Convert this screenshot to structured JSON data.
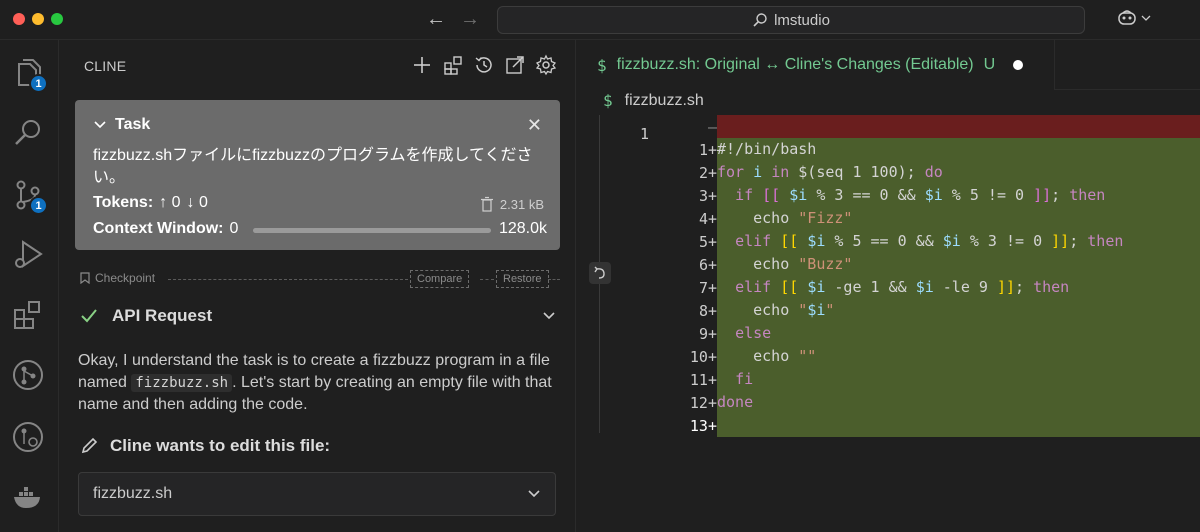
{
  "window": {
    "search_text": "lmstudio"
  },
  "activity": {
    "explorer_badge": "1",
    "scm_badge": "1"
  },
  "sidebar": {
    "title": "CLINE",
    "task": {
      "heading": "Task",
      "text": "fizzbuzz.shファイルにfizzbuzzのプログラムを作成してください。",
      "tokens_label": "Tokens:",
      "tokens_up": "↑ 0",
      "tokens_down": "↓ 0",
      "size": "2.31 kB",
      "context_label": "Context Window:",
      "context_used": "0",
      "context_max": "128.0k"
    },
    "checkpoint": {
      "label": "Checkpoint",
      "compare": "Compare",
      "restore": "Restore"
    },
    "api_request": "API Request",
    "message_before": "Okay, I understand the task is to create a fizzbuzz program in a file named ",
    "message_code": "fizzbuzz.sh",
    "message_after": ". Let's start by creating an empty file with that name and then adding the code.",
    "edit_heading": "Cline wants to edit this file:",
    "edit_file": "fizzbuzz.sh"
  },
  "editor": {
    "tab_title": "fizzbuzz.sh: Original ↔ Cline's Changes (Editable)",
    "tab_status": "U",
    "breadcrumb": "fizzbuzz.sh",
    "original_line_number": "1",
    "lines": [
      {
        "n": "",
        "marker": "—"
      },
      {
        "n": "1",
        "marker": "+"
      },
      {
        "n": "2",
        "marker": "+"
      },
      {
        "n": "3",
        "marker": "+"
      },
      {
        "n": "4",
        "marker": "+"
      },
      {
        "n": "5",
        "marker": "+"
      },
      {
        "n": "6",
        "marker": "+"
      },
      {
        "n": "7",
        "marker": "+"
      },
      {
        "n": "8",
        "marker": "+"
      },
      {
        "n": "9",
        "marker": "+"
      },
      {
        "n": "10",
        "marker": "+"
      },
      {
        "n": "11",
        "marker": "+"
      },
      {
        "n": "12",
        "marker": "+"
      },
      {
        "n": "13",
        "marker": "+"
      }
    ],
    "code": {
      "l1": "#!/bin/bash",
      "l2": "for i in $(seq 1 100); do",
      "l3": "  if [[ $i % 3 == 0 && $i % 5 != 0 ]]; then",
      "l4": "    echo \"Fizz\"",
      "l5": "  elif [[ $i % 5 == 0 && $i % 3 != 0 ]]; then",
      "l6": "    echo \"Buzz\"",
      "l7": "  elif [[ $i -ge 1 && $i -le 9 ]]; then",
      "l8": "    echo \"$i\"",
      "l9": "  else",
      "l10": "    echo \"\"",
      "l11": "  fi",
      "l12": "done"
    }
  }
}
